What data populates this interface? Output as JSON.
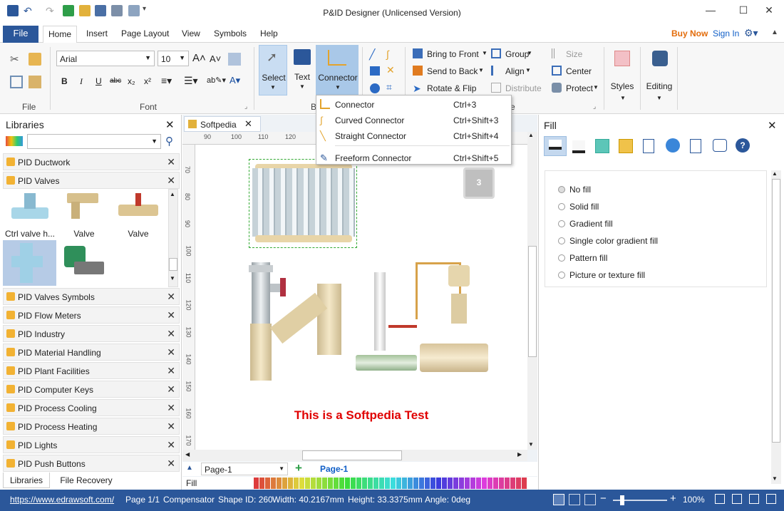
{
  "app": {
    "title": "P&ID Designer (Unlicensed Version)"
  },
  "menu": {
    "file": "File",
    "tabs": [
      "Home",
      "Insert",
      "Page Layout",
      "View",
      "Symbols",
      "Help"
    ],
    "buy_now": "Buy Now",
    "sign_in": "Sign In"
  },
  "ribbon": {
    "font_name": "Arial",
    "font_size": "10",
    "group_file": "File",
    "group_font": "Font",
    "group_b": "B",
    "group_e": "e",
    "select_label": "Select",
    "text_label": "Text",
    "connector_label": "Connector",
    "bring_front": "Bring to Front",
    "send_back": "Send to Back",
    "rotate_flip": "Rotate & Flip",
    "group": "Group",
    "align": "Align",
    "distribute": "Distribute",
    "size": "Size",
    "center": "Center",
    "protect": "Protect",
    "styles": "Styles",
    "editing": "Editing"
  },
  "connector_menu": [
    {
      "label": "Connector",
      "shortcut": "Ctrl+3"
    },
    {
      "label": "Curved Connector",
      "shortcut": "Ctrl+Shift+3"
    },
    {
      "label": "Straight Connector",
      "shortcut": "Ctrl+Shift+4"
    },
    {
      "label": "Freeform Connector",
      "shortcut": "Ctrl+Shift+5"
    }
  ],
  "libraries": {
    "title": "Libraries",
    "items": [
      "PID Ductwork",
      "PID Valves",
      "PID Valves Symbols",
      "PID Flow Meters",
      "PID Industry",
      "PID Material Handling",
      "PID Plant Facilities",
      "PID Computer Keys",
      "PID Process Cooling",
      "PID Process Heating",
      "PID Lights",
      "PID Push Buttons"
    ],
    "valve_thumbs": [
      "Ctrl valve h...",
      "Valve",
      "Valve"
    ],
    "bottom_tabs": [
      "Libraries",
      "File Recovery"
    ]
  },
  "document": {
    "tab": "Softpedia",
    "ruler_h": [
      "90",
      "100",
      "110",
      "120"
    ],
    "ruler_v": [
      "70",
      "80",
      "90",
      "100",
      "110",
      "120",
      "130",
      "140",
      "150",
      "160",
      "170"
    ],
    "key_label": "3",
    "caption": "This is a Softpedia Test",
    "caption_color": "#e00000",
    "page_select": "Page-1",
    "page_tab": "Page-1",
    "fill_label": "Fill"
  },
  "fill_panel": {
    "title": "Fill",
    "options": [
      "No fill",
      "Solid fill",
      "Gradient fill",
      "Single color gradient fill",
      "Pattern fill",
      "Picture or texture fill"
    ],
    "selected": 0
  },
  "status": {
    "url": "https://www.edrawsoft.com/",
    "page": "Page 1/1",
    "shape": "Compensator",
    "shape_id": "Shape ID: 260",
    "width": "Width: 40.2167mm",
    "height": "Height: 33.3375mm",
    "angle": "Angle: 0deg",
    "zoom": "100%"
  },
  "colors": {
    "accent": "#2b579a",
    "buy_now": "#e36c0a",
    "link": "#0f5ec7"
  }
}
